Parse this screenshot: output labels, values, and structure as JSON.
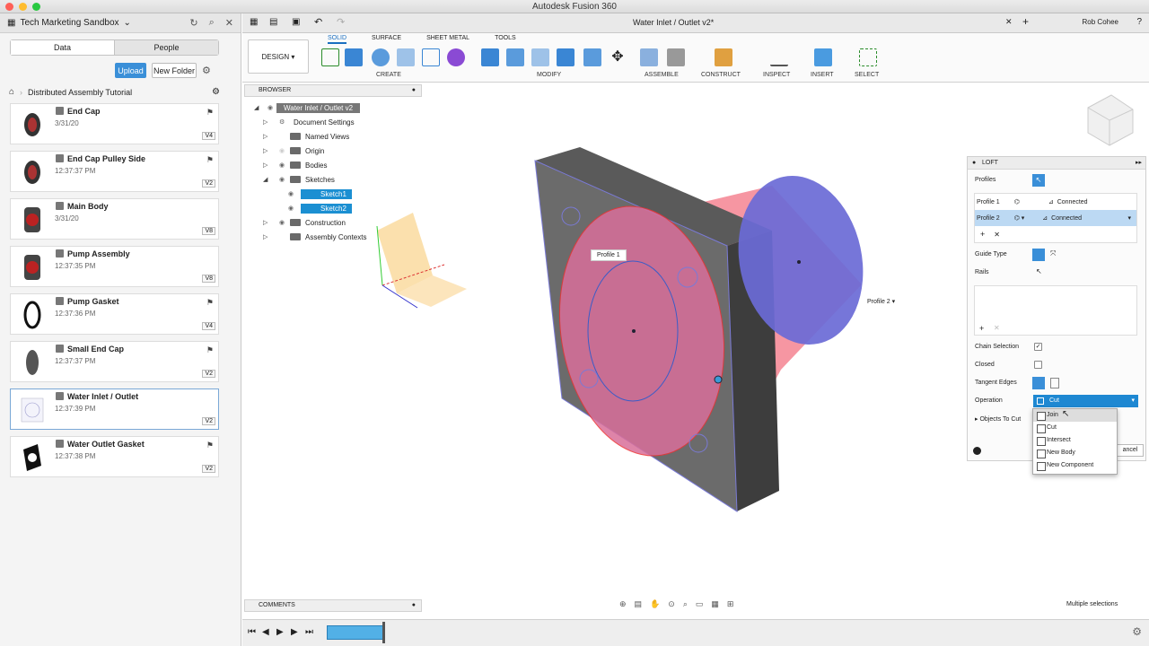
{
  "app": {
    "title": "Autodesk Fusion 360"
  },
  "data_panel": {
    "project": "Tech Marketing Sandbox",
    "tabs": [
      "Data",
      "People"
    ],
    "upload_label": "Upload",
    "new_folder_label": "New Folder",
    "folder": "Distributed Assembly Tutorial",
    "items": [
      {
        "name": "End Cap",
        "date": "3/31/20",
        "version": "V4"
      },
      {
        "name": "End Cap Pulley Side",
        "date": "12:37:37 PM",
        "version": "V2"
      },
      {
        "name": "Main Body",
        "date": "3/31/20",
        "version": "V8"
      },
      {
        "name": "Pump Assembly",
        "date": "12:37:35 PM",
        "version": "V8"
      },
      {
        "name": "Pump Gasket",
        "date": "12:37:36 PM",
        "version": "V4"
      },
      {
        "name": "Small End Cap",
        "date": "12:37:37 PM",
        "version": "V2"
      },
      {
        "name": "Water Inlet / Outlet",
        "date": "12:37:39 PM",
        "version": "V2"
      },
      {
        "name": "Water Outlet Gasket",
        "date": "12:37:38 PM",
        "version": "V2"
      }
    ]
  },
  "doc_tab": {
    "title": "Water Inlet / Outlet v2*",
    "user": "Rob Cohee"
  },
  "toolbar": {
    "workspace": "DESIGN",
    "tabs": [
      "SOLID",
      "SURFACE",
      "SHEET METAL",
      "TOOLS"
    ],
    "groups": [
      "CREATE",
      "MODIFY",
      "ASSEMBLE",
      "CONSTRUCT",
      "INSPECT",
      "INSERT",
      "SELECT"
    ]
  },
  "browser": {
    "header": "BROWSER",
    "root": "Water Inlet / Outlet v2",
    "nodes": [
      "Document Settings",
      "Named Views",
      "Origin",
      "Bodies",
      "Sketches",
      "Sketch1",
      "Sketch2",
      "Construction",
      "Assembly Contexts"
    ]
  },
  "viewport": {
    "profile1_label": "Profile 1",
    "profile2_label": "Profile 2"
  },
  "loft": {
    "title": "LOFT",
    "profiles_label": "Profiles",
    "profile_rows": [
      {
        "name": "Profile 1",
        "mode": "Connected"
      },
      {
        "name": "Profile 2",
        "mode": "Connected"
      }
    ],
    "guide_type_label": "Guide Type",
    "rails_label": "Rails",
    "chain_selection_label": "Chain Selection",
    "closed_label": "Closed",
    "tangent_edges_label": "Tangent Edges",
    "operation_label": "Operation",
    "operation_value": "Cut",
    "objects_to_cut_label": "Objects To Cut",
    "cancel_label": "ancel",
    "options": [
      "Join",
      "Cut",
      "Intersect",
      "New Body",
      "New Component"
    ]
  },
  "comments": {
    "header": "COMMENTS"
  },
  "status": {
    "text": "Multiple selections"
  }
}
